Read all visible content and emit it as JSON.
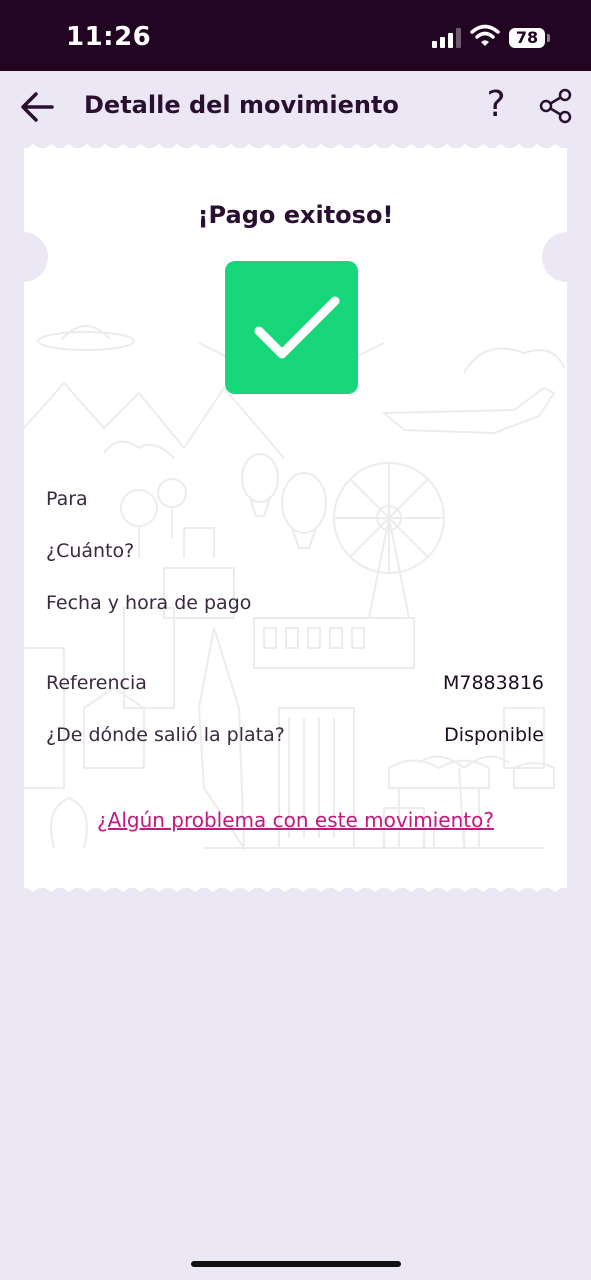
{
  "status_bar": {
    "time": "11:26",
    "battery": "78"
  },
  "header": {
    "title": "Detalle del movimiento",
    "help_label": "?"
  },
  "receipt": {
    "title": "¡Pago exitoso!",
    "rows": [
      {
        "label": "Para",
        "value": ""
      },
      {
        "label": "¿Cuánto?",
        "value": ""
      },
      {
        "label": "Fecha y hora de pago",
        "value": ""
      },
      {
        "label": "Referencia",
        "value": "M7883816"
      },
      {
        "label": "¿De dónde salió la plata?",
        "value": "Disponible"
      }
    ],
    "problem_link": "¿Algún problema con este movimiento?"
  },
  "colors": {
    "status_bar": "#210523",
    "background": "#ebe7f5",
    "success": "#17d77a",
    "link": "#c2187f",
    "text": "#2a1030"
  },
  "icons": [
    "cellular-signal-icon",
    "wifi-icon",
    "battery-icon",
    "back-arrow-icon",
    "help-icon",
    "share-icon",
    "checkmark-icon"
  ]
}
